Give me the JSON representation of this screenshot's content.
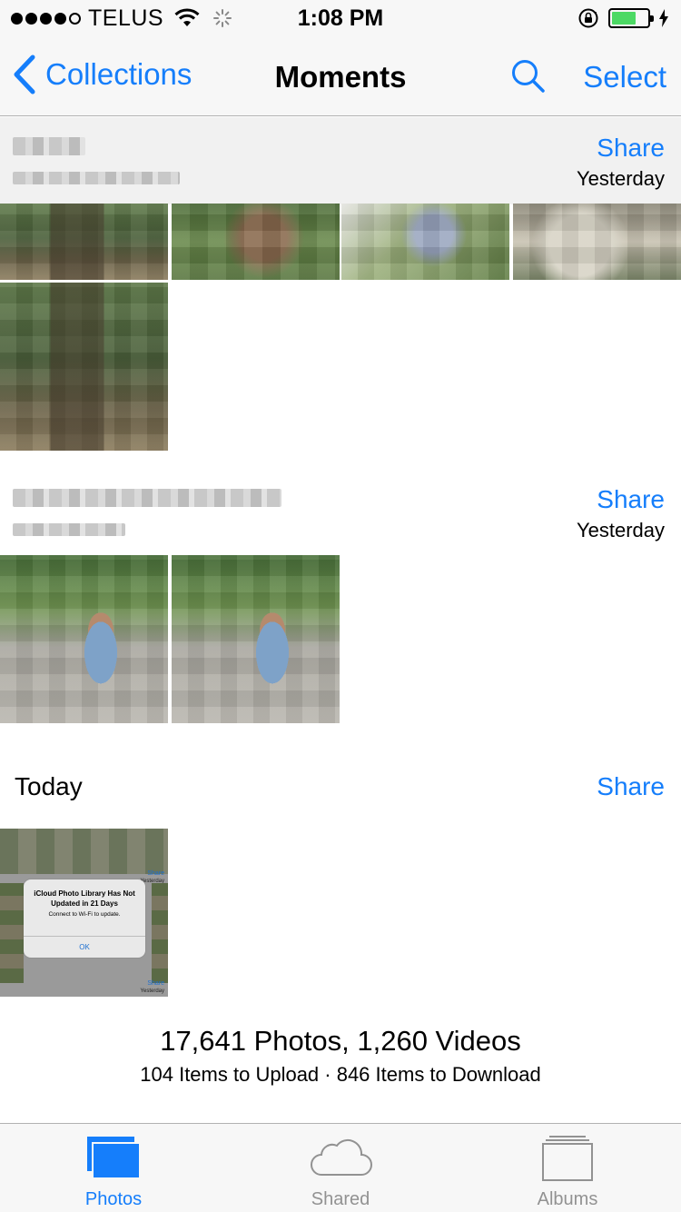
{
  "status_bar": {
    "carrier": "TELUS",
    "time": "1:08 PM",
    "signal_bars": 4,
    "battery_level": 0.62,
    "battery_color": "#4cd964"
  },
  "nav": {
    "back_label": "Collections",
    "title": "Moments",
    "select_label": "Select",
    "icons": {
      "back": "chevron-left-icon",
      "search": "search-icon"
    }
  },
  "moments": [
    {
      "title": "",
      "share_label": "Share",
      "date": "Yesterday",
      "photos": 5
    },
    {
      "title": "",
      "share_label": "Share",
      "date": "Yesterday",
      "photos": 2
    },
    {
      "title": "Today",
      "share_label": "Share",
      "date": "",
      "photos": 1
    }
  ],
  "screenshot_thumb": {
    "alert_title": "iCloud Photo Library Has Not Updated in 21 Days",
    "alert_message": "Connect to Wi-Fi to update.",
    "alert_button": "OK",
    "mini_share": "Share",
    "mini_date": "Yesterday"
  },
  "summary": {
    "counts": "17,641 Photos, 1,260 Videos",
    "sub": "104 Items to Upload · 846 Items to Download"
  },
  "tabs": [
    {
      "label": "Photos",
      "icon": "photos-icon",
      "active": true
    },
    {
      "label": "Shared",
      "icon": "cloud-icon",
      "active": false
    },
    {
      "label": "Albums",
      "icon": "albums-icon",
      "active": false
    }
  ],
  "colors": {
    "accent": "#157efb",
    "inactive": "#929292"
  }
}
